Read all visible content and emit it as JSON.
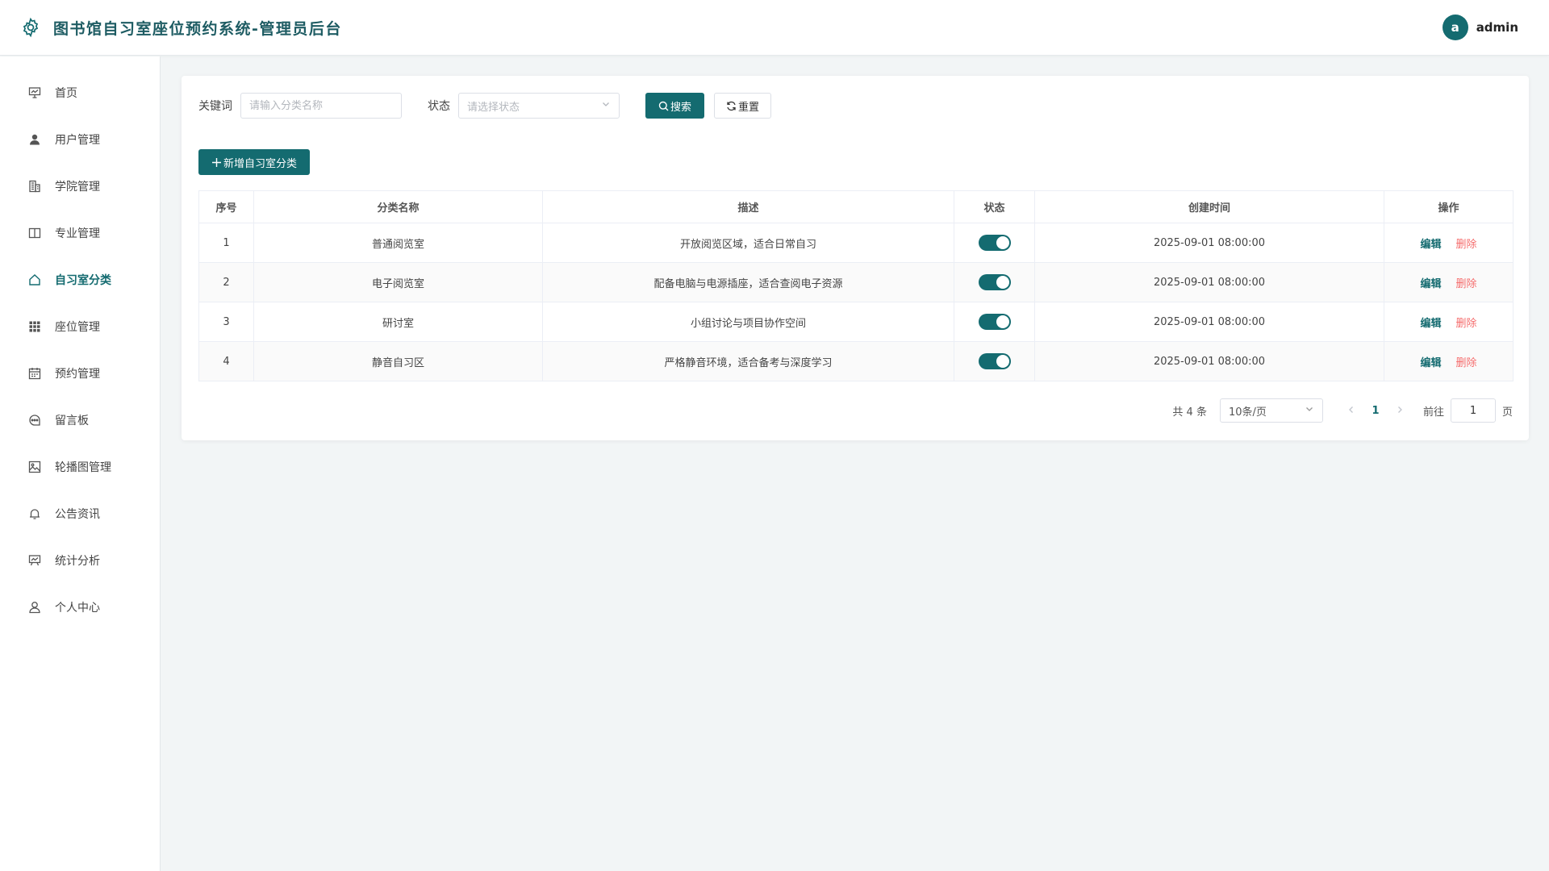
{
  "header": {
    "title": "图书馆自习室座位预约系统-管理员后台",
    "logo_icon": "gear-icon",
    "avatar_letter": "a",
    "username": "admin"
  },
  "colors": {
    "brand": "#146b70",
    "danger": "#f56c6c",
    "background": "#f2f5f6"
  },
  "sidebar": {
    "items": [
      {
        "label": "首页",
        "icon": "presentation-icon",
        "active": false
      },
      {
        "label": "用户管理",
        "icon": "user-icon",
        "active": false
      },
      {
        "label": "学院管理",
        "icon": "building-icon",
        "active": false
      },
      {
        "label": "专业管理",
        "icon": "book-icon",
        "active": false
      },
      {
        "label": "自习室分类",
        "icon": "home-icon",
        "active": true
      },
      {
        "label": "座位管理",
        "icon": "grid-icon",
        "active": false
      },
      {
        "label": "预约管理",
        "icon": "calendar-icon",
        "active": false
      },
      {
        "label": "留言板",
        "icon": "chat-icon",
        "active": false
      },
      {
        "label": "轮播图管理",
        "icon": "image-icon",
        "active": false
      },
      {
        "label": "公告资讯",
        "icon": "bell-icon",
        "active": false
      },
      {
        "label": "统计分析",
        "icon": "chart-board-icon",
        "active": false
      },
      {
        "label": "个人中心",
        "icon": "person-icon",
        "active": false
      }
    ]
  },
  "filters": {
    "keyword_label": "关键词",
    "keyword_value": "",
    "keyword_placeholder": "请输入分类名称",
    "status_label": "状态",
    "status_placeholder": "请选择状态",
    "search_label": "搜索",
    "reset_label": "重置"
  },
  "toolbar": {
    "add_label": "新增自习室分类"
  },
  "table": {
    "columns": [
      "序号",
      "分类名称",
      "描述",
      "状态",
      "创建时间",
      "操作"
    ],
    "rows": [
      {
        "index": "1",
        "name": "普通阅览室",
        "description": "开放阅览区域，适合日常自习",
        "enabled": true,
        "created": "2025-09-01 08:00:00"
      },
      {
        "index": "2",
        "name": "电子阅览室",
        "description": "配备电脑与电源插座，适合查阅电子资源",
        "enabled": true,
        "created": "2025-09-01 08:00:00"
      },
      {
        "index": "3",
        "name": "研讨室",
        "description": "小组讨论与项目协作空间",
        "enabled": true,
        "created": "2025-09-01 08:00:00"
      },
      {
        "index": "4",
        "name": "静音自习区",
        "description": "严格静音环境，适合备考与深度学习",
        "enabled": true,
        "created": "2025-09-01 08:00:00"
      }
    ],
    "edit_label": "编辑",
    "delete_label": "删除"
  },
  "pagination": {
    "total_text": "共 4 条",
    "page_size": "10条/页",
    "current_page": "1",
    "goto_prefix": "前往",
    "goto_value": "1",
    "goto_suffix": "页"
  }
}
